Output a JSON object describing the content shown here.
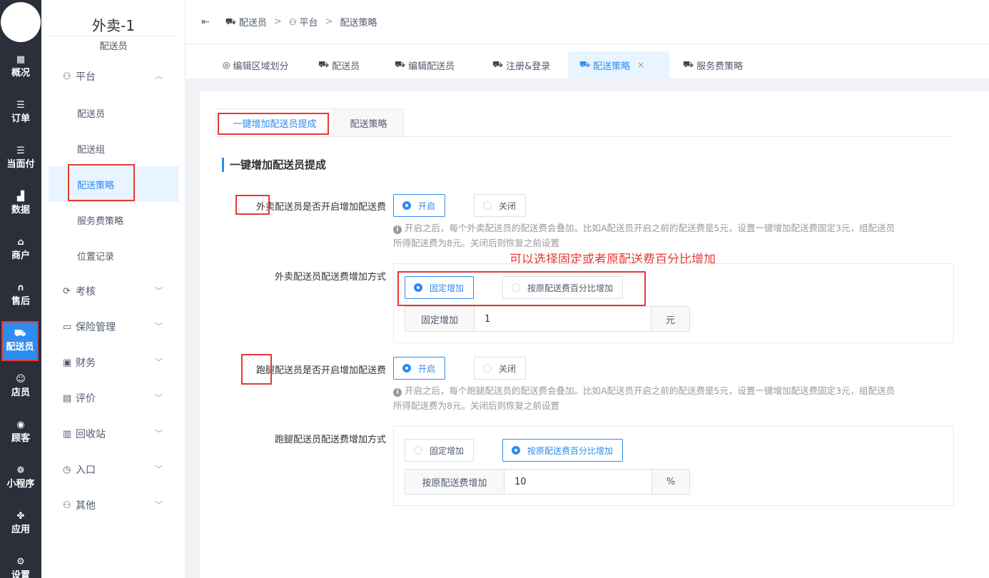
{
  "rail": {
    "items": [
      {
        "label": "概况",
        "icon": "grid-icon",
        "glyph": "▦"
      },
      {
        "label": "订单",
        "icon": "list-icon",
        "glyph": "☰"
      },
      {
        "label": "当面付",
        "icon": "list-icon",
        "glyph": "☰"
      },
      {
        "label": "数据",
        "icon": "bar-chart-icon",
        "glyph": "▟"
      },
      {
        "label": "商户",
        "icon": "store-icon",
        "glyph": "⌂"
      },
      {
        "label": "售后",
        "icon": "headset-icon",
        "glyph": "∩"
      },
      {
        "label": "配送员",
        "icon": "truck-icon",
        "glyph": "⛟"
      },
      {
        "label": "店员",
        "icon": "users-icon",
        "glyph": "☺"
      },
      {
        "label": "顾客",
        "icon": "user-circle-icon",
        "glyph": "◉"
      },
      {
        "label": "小程序",
        "icon": "wechat-icon",
        "glyph": "❁"
      },
      {
        "label": "应用",
        "icon": "apps-icon",
        "glyph": "✤"
      },
      {
        "label": "设置",
        "icon": "settings-user-icon",
        "glyph": "⚙"
      }
    ]
  },
  "menu": {
    "title": "外卖-1",
    "subtitle": "配送员",
    "group_platform": "平台",
    "sub_items": [
      "配送员",
      "配送组",
      "配送策略",
      "服务费策略",
      "位置记录"
    ],
    "groups": [
      "考核",
      "保险管理",
      "财务",
      "评价",
      "回收站",
      "入口",
      "其他"
    ]
  },
  "header": {
    "crumbs": [
      "配送员",
      "平台",
      "配送策略"
    ]
  },
  "tabs": [
    "编辑区域划分",
    "配送员",
    "编辑配送员",
    "注册&登录",
    "配送策略",
    "服务费策略"
  ],
  "inner_tabs": [
    "一键增加配送员提成",
    "配送策略"
  ],
  "section_title": "一键增加配送员提成",
  "form": {
    "takeout_enable_label": "外卖配送员是否开启增加配送费",
    "on": "开启",
    "off": "关闭",
    "takeout_hint_1": "开启之后，每个外卖配送员的配送费会叠加。比如A配送员开启之前的配送费是5元，设置一键增加配送费固定3元，组配送员",
    "takeout_hint_2": "所得配送费为8元。关闭后则恢复之前设置",
    "takeout_method_label": "外卖配送员配送费增加方式",
    "fixed": "固定增加",
    "percent": "按原配送费百分比增加",
    "fixed_prepend": "固定增加",
    "fixed_value": "1",
    "fixed_unit": "元",
    "runner_enable_label": "跑腿配送员是否开启增加配送费",
    "runner_hint_1": "开启之后，每个跑腿配送员的配送费会叠加。比如A配送员开启之前的配送费是5元，设置一键增加配送费固定3元，组配送员",
    "runner_hint_2": "所得配送费为8元。关闭后则恢复之前设置",
    "runner_method_label": "跑腿配送员配送费增加方式",
    "percent_prepend": "按原配送费增加",
    "percent_value": "10",
    "percent_unit": "%"
  },
  "annotation": "可以选择固定或者原配送费百分比增加"
}
